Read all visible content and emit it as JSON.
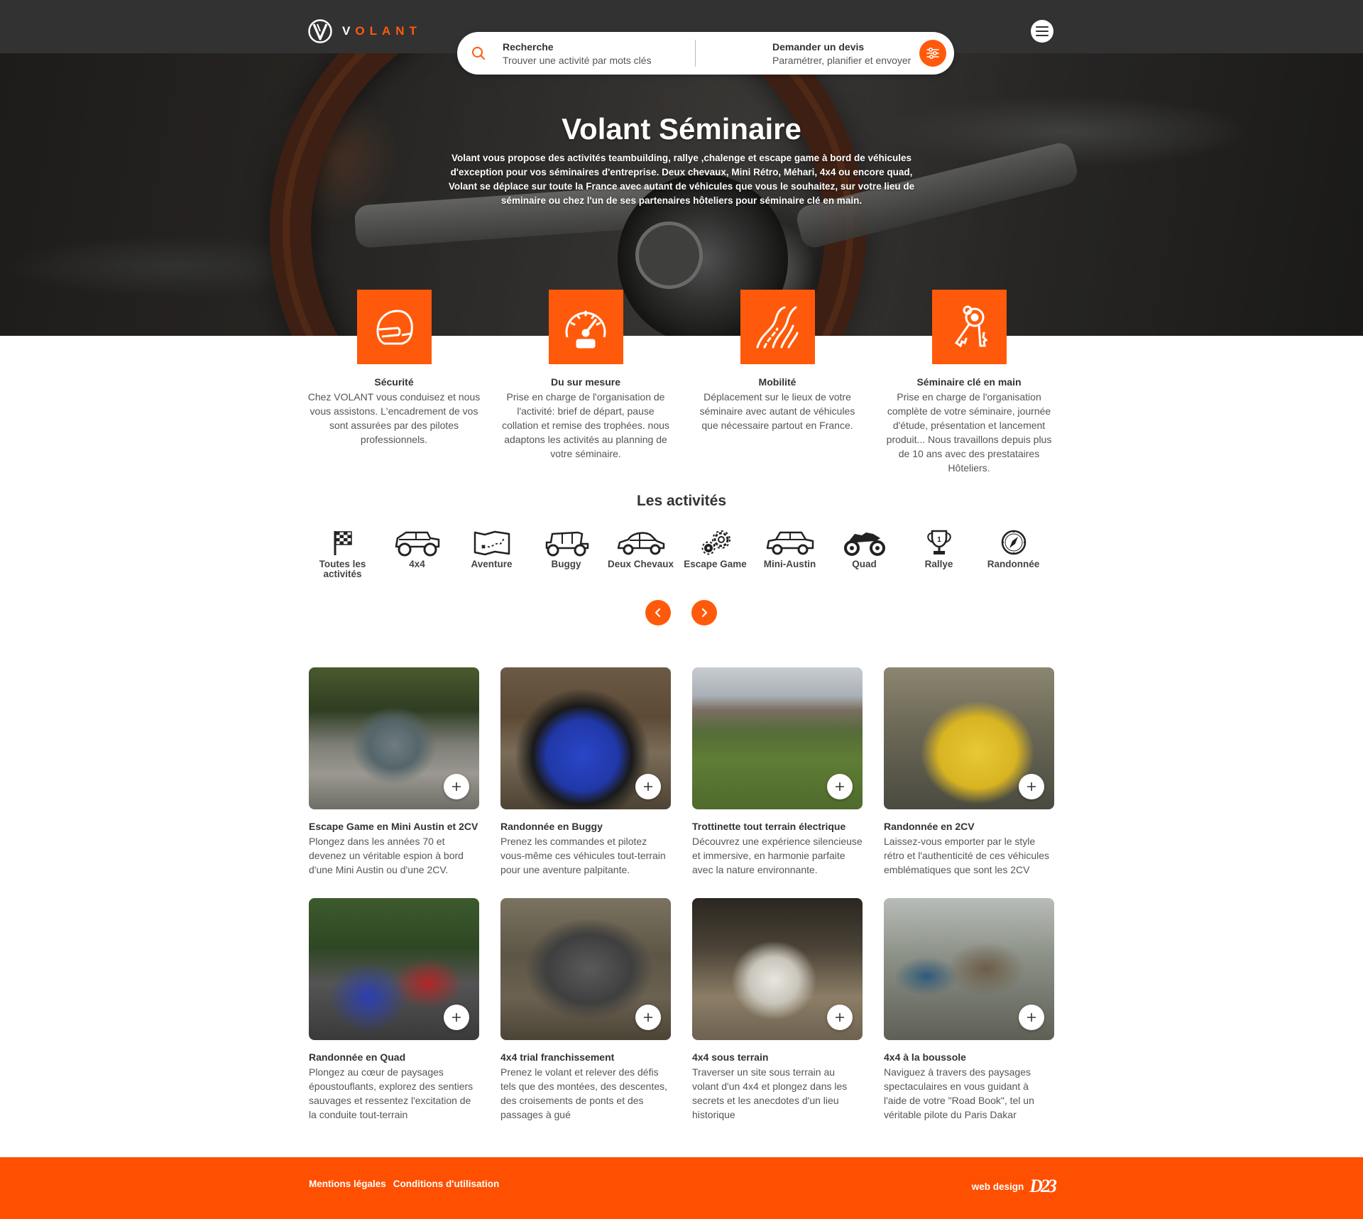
{
  "brand": {
    "name": "VOLANT",
    "first_letter": "V",
    "rest": "OLANT",
    "accent_color": "#ff5a0b"
  },
  "search": {
    "left_title": "Recherche",
    "left_sub": "Trouver une activité par mots clés",
    "right_title": "Demander un devis",
    "right_sub": "Paramétrer, planifier et envoyer"
  },
  "hero": {
    "title": "Volant Séminaire",
    "text": "Volant vous propose des activités teambuilding, rallye ,chalenge et escape game à bord de véhicules d'exception pour vos séminaires d'entreprise. Deux chevaux, Mini Rétro, Méhari, 4x4 ou encore quad, Volant se déplace sur toute la France avec autant de véhicules que vous le souhaitez, sur votre lieu de séminaire ou chez l'un de ses partenaires hôteliers pour séminaire clé en main."
  },
  "features": [
    {
      "icon": "helmet-icon",
      "title": "Sécurité",
      "text": "Chez VOLANT vous conduisez et nous vous assistons. L'encadrement de vos sont assurées par des pilotes professionnels."
    },
    {
      "icon": "speedometer-icon",
      "title": "Du sur mesure",
      "text": "Prise en charge de l'organisation de l'activité: brief de départ, pause collation et remise des trophées. nous adaptons les activités au planning de votre séminaire."
    },
    {
      "icon": "road-icon",
      "title": "Mobilité",
      "text": "Déplacement sur le lieux de votre séminaire avec autant de véhicules que nécessaire partout en France."
    },
    {
      "icon": "keys-icon",
      "title": "Séminaire clé en main",
      "text": "Prise en charge de l'organisation complète de votre séminaire, journée d'étude, présentation et lancement produit... Nous travaillons depuis plus de 10 ans avec des prestataires Hôteliers."
    }
  ],
  "activities": {
    "title": "Les activités",
    "items": [
      {
        "icon": "checkered-flag-icon",
        "label": "Toutes les activités"
      },
      {
        "icon": "4x4-icon",
        "label": "4x4"
      },
      {
        "icon": "map-icon",
        "label": "Aventure"
      },
      {
        "icon": "buggy-icon",
        "label": "Buggy"
      },
      {
        "icon": "deux-chevaux-icon",
        "label": "Deux Chevaux"
      },
      {
        "icon": "gears-icon",
        "label": "Escape Game"
      },
      {
        "icon": "mini-austin-icon",
        "label": "Mini-Austin"
      },
      {
        "icon": "quad-icon",
        "label": "Quad"
      },
      {
        "icon": "trophy-icon",
        "label": "Rallye"
      },
      {
        "icon": "compass-icon",
        "label": "Randonnée"
      }
    ]
  },
  "cards": [
    {
      "title": "Escape Game en Mini Austin et 2CV",
      "text": "Plongez dans les années 70 et devenez un véritable espion à bord d'une Mini Austin ou d'une 2CV."
    },
    {
      "title": "Randonnée en Buggy",
      "text": "Prenez les commandes et pilotez vous-même ces véhicules tout-terrain pour une aventure palpitante."
    },
    {
      "title": "Trottinette tout terrain électrique",
      "text": "Découvrez une expérience silencieuse et immersive, en harmonie parfaite avec la nature environnante."
    },
    {
      "title": "Randonnée en 2CV",
      "text": "Laissez-vous emporter par le style rétro et l'authenticité de ces véhicules emblématiques que sont les 2CV"
    },
    {
      "title": "Randonnée en Quad",
      "text": "Plongez au cœur de paysages époustouflants, explorez des sentiers sauvages et ressentez l'excitation de la conduite tout-terrain"
    },
    {
      "title": "4x4 trial franchissement",
      "text": "Prenez le volant et relever des défis tels que des montées, des descentes, des croisements de ponts et des passages à gué"
    },
    {
      "title": "4x4 sous terrain",
      "text": "Traverser un site sous terrain au volant d'un 4x4 et plongez dans les secrets et les anecdotes d'un lieu historique"
    },
    {
      "title": "4x4 à la boussole",
      "text": "Naviguez à travers des paysages spectaculaires en vous guidant à l'aide de votre \"Road Book\", tel un véritable pilote du Paris Dakar"
    }
  ],
  "footer": {
    "legal": "Mentions légales",
    "terms": "Conditions d'utilisation",
    "credit": "web design",
    "credit_logo": "D23"
  }
}
